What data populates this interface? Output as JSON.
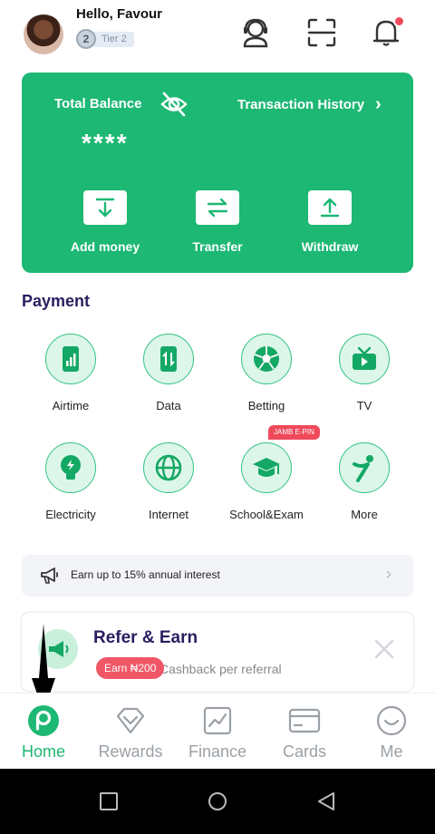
{
  "header": {
    "greeting": "Hello, Favour",
    "tier_number": "2",
    "tier_label": "Tier 2",
    "icons": [
      "support-agent-icon",
      "scan-icon",
      "bell-icon"
    ]
  },
  "balance_card": {
    "total_balance_label": "Total Balance",
    "balance_masked": "****",
    "transaction_history_label": "Transaction History",
    "actions": [
      {
        "label": "Add money",
        "icon": "download-icon"
      },
      {
        "label": "Transfer",
        "icon": "swap-arrows-icon"
      },
      {
        "label": "Withdraw",
        "icon": "upload-icon"
      }
    ]
  },
  "payment": {
    "title": "Payment",
    "items": [
      {
        "label": "Airtime",
        "icon": "phone-signal-icon"
      },
      {
        "label": "Data",
        "icon": "phone-data-icon"
      },
      {
        "label": "Betting",
        "icon": "football-icon"
      },
      {
        "label": "TV",
        "icon": "tv-icon"
      },
      {
        "label": "Electricity",
        "icon": "bulb-icon"
      },
      {
        "label": "Internet",
        "icon": "globe-icon"
      },
      {
        "label": "School&Exam",
        "icon": "graduation-cap-icon"
      },
      {
        "label": "More",
        "icon": "more-figure-icon"
      }
    ],
    "school_badge": "JAMB E-PIN"
  },
  "interest_banner": {
    "text": "Earn up to 15% annual interest"
  },
  "refer_card": {
    "title": "Refer & Earn",
    "pill": "Earn ₦200",
    "subtitle": "Cashback per referral"
  },
  "bottom_nav": {
    "items": [
      {
        "label": "Home",
        "active": true
      },
      {
        "label": "Rewards",
        "active": false
      },
      {
        "label": "Finance",
        "active": false
      },
      {
        "label": "Cards",
        "active": false
      },
      {
        "label": "Me",
        "active": false
      }
    ]
  },
  "colors": {
    "brand_green": "#1db873",
    "accent_red": "#ef4a5b",
    "title_purple": "#2b1d5f"
  }
}
